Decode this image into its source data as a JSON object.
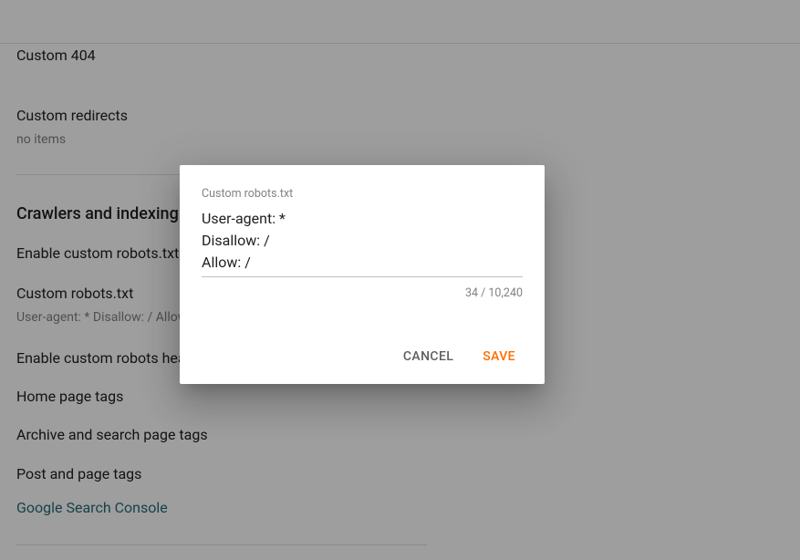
{
  "bg": {
    "custom_404": "Custom 404",
    "custom_redirects": {
      "title": "Custom redirects",
      "sub": "no items"
    },
    "section_crawlers": "Crawlers and indexing",
    "enable_robots": "Enable custom robots.txt",
    "custom_robots": {
      "title": "Custom robots.txt",
      "sub": "User-agent: * Disallow: / Allow: /"
    },
    "enable_header": "Enable custom robots header tags",
    "home_tags": "Home page tags",
    "archive_tags": "Archive and search page tags",
    "post_tags": "Post and page tags",
    "gsc": "Google Search Console"
  },
  "dialog": {
    "label": "Custom robots.txt",
    "value": "User-agent: *\nDisallow: /\nAllow: /",
    "counter": "34 / 10,240",
    "cancel": "CANCEL",
    "save": "SAVE"
  }
}
